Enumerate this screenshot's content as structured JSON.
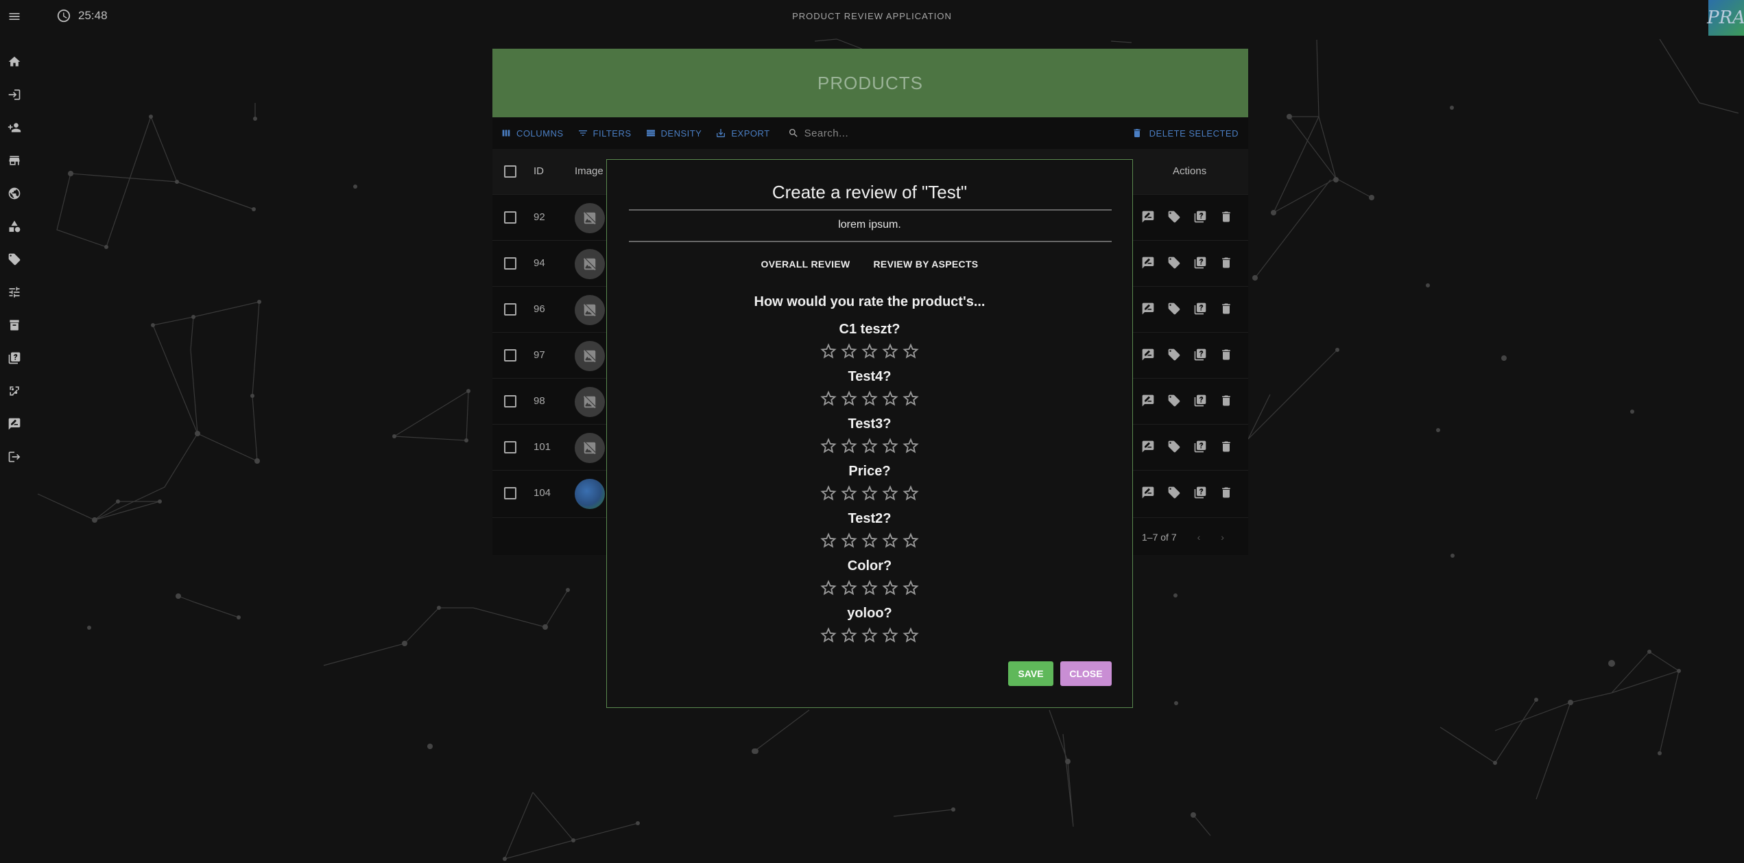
{
  "topbar": {
    "clock_time": "25:48",
    "app_title": "PRODUCT REVIEW APPLICATION",
    "logo_text": "PRA"
  },
  "sidebar": {
    "items": [
      {
        "icon": "menu-icon"
      },
      {
        "icon": "home-icon"
      },
      {
        "icon": "login-icon"
      },
      {
        "icon": "add-user-icon"
      },
      {
        "icon": "store-icon"
      },
      {
        "icon": "globe-icon"
      },
      {
        "icon": "category-icon"
      },
      {
        "icon": "tag-icon"
      },
      {
        "icon": "tune-icon"
      },
      {
        "icon": "archive-icon"
      },
      {
        "icon": "quiz-icon"
      },
      {
        "icon": "percent-icon"
      },
      {
        "icon": "rate-review-icon"
      },
      {
        "icon": "logout-icon"
      }
    ]
  },
  "products": {
    "title": "PRODUCTS",
    "toolbar": {
      "columns": "COLUMNS",
      "filters": "FILTERS",
      "density": "DENSITY",
      "export": "EXPORT",
      "search_placeholder": "Search...",
      "delete_selected": "DELETE SELECTED"
    },
    "headers": {
      "id": "ID",
      "image": "Image",
      "actions": "Actions"
    },
    "rows": [
      {
        "id": "92"
      },
      {
        "id": "94"
      },
      {
        "id": "96"
      },
      {
        "id": "97"
      },
      {
        "id": "98"
      },
      {
        "id": "101"
      },
      {
        "id": "104"
      }
    ],
    "pagination": "1–7 of 7"
  },
  "modal": {
    "title": "Create a review of \"Test\"",
    "description": "lorem ipsum.",
    "tabs": [
      "OVERALL REVIEW",
      "REVIEW BY ASPECTS"
    ],
    "question": "How would you rate the product's...",
    "aspects": [
      {
        "name": "C1 teszt?",
        "rating": 0,
        "max": 5
      },
      {
        "name": "Test4?",
        "rating": 0,
        "max": 5
      },
      {
        "name": "Test3?",
        "rating": 0,
        "max": 5
      },
      {
        "name": "Price?",
        "rating": 0,
        "max": 5
      },
      {
        "name": "Test2?",
        "rating": 0,
        "max": 5
      },
      {
        "name": "Color?",
        "rating": 0,
        "max": 5
      },
      {
        "name": "yoloo?",
        "rating": 0,
        "max": 5
      }
    ],
    "save_label": "SAVE",
    "close_label": "CLOSE"
  },
  "colors": {
    "header_green": "#4d7543",
    "accent_blue": "#4b7fc4",
    "save_green": "#5fb85a",
    "close_purple": "#c98ed4",
    "modal_border": "#5a8a4f"
  }
}
